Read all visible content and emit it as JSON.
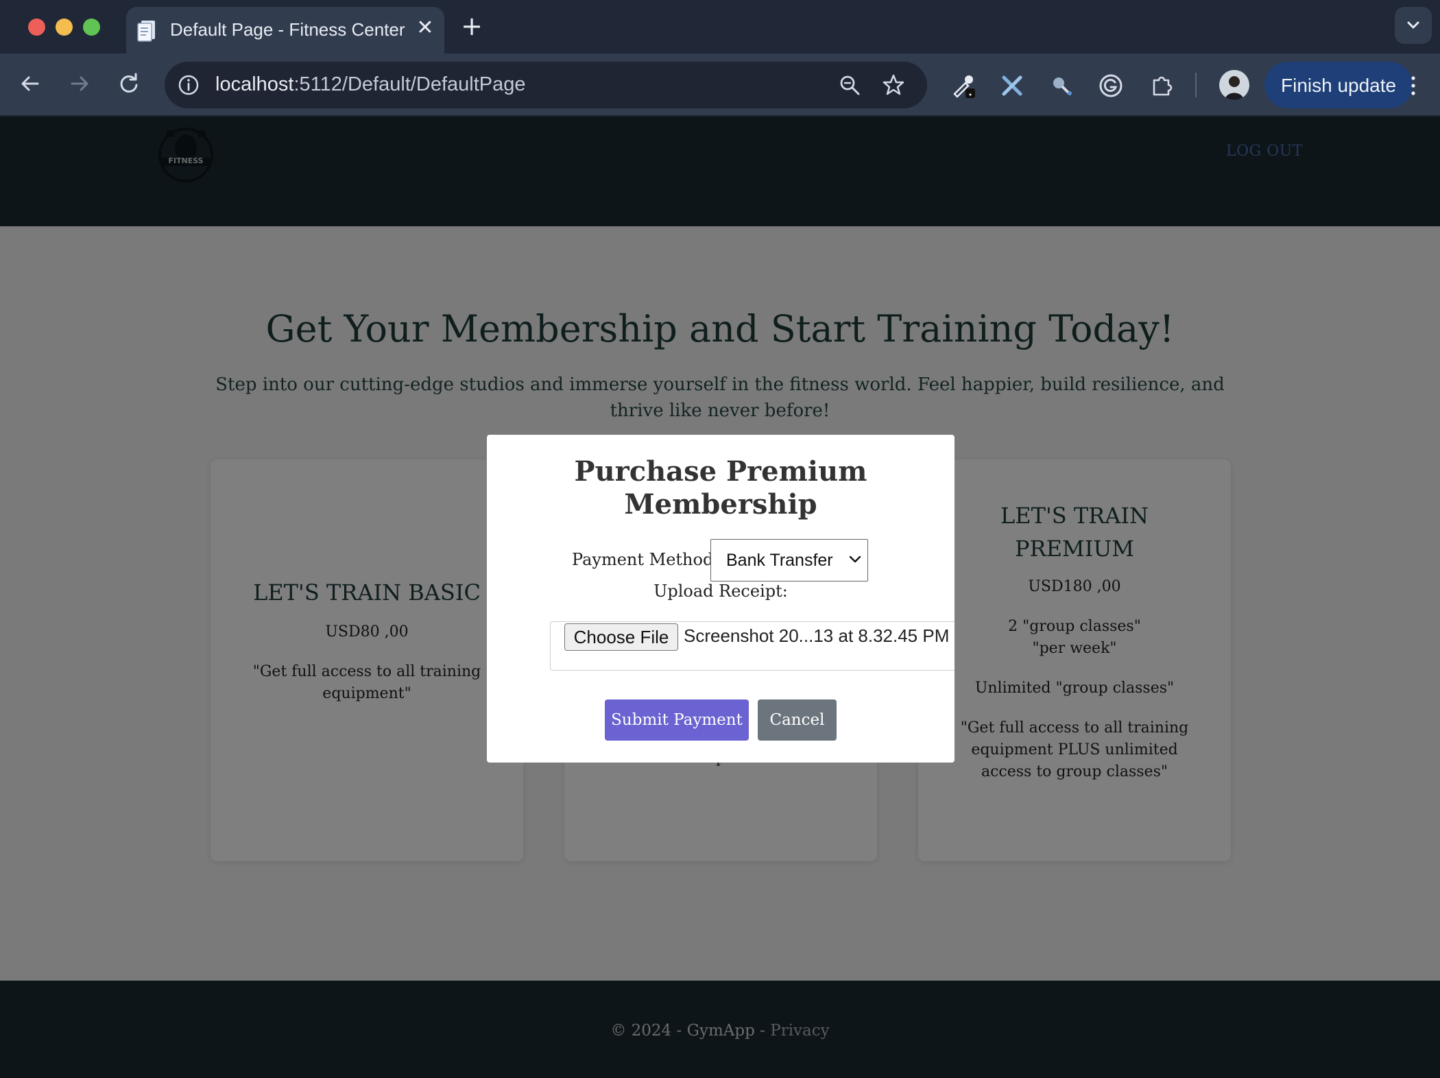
{
  "browser": {
    "tab_title": "Default Page - Fitness Center",
    "tab_close_glyph": "✕",
    "new_tab_glyph": "+",
    "url_host": "localhost",
    "url_path": ":5112/Default/DefaultPage",
    "finish_update_label": "Finish update",
    "icons": [
      "back-icon",
      "forward-icon",
      "reload-icon",
      "info-icon",
      "zoom-icon",
      "star-icon",
      "eyedropper-icon",
      "tools-icon",
      "search-extension-icon",
      "grammarly-icon",
      "extensions-icon",
      "avatar",
      "kebab-menu-icon"
    ]
  },
  "header": {
    "logo_text": "FITNESS",
    "logout_label": "LOG OUT"
  },
  "hero": {
    "title": "Get Your Membership and Start Training Today!",
    "text": "Step into our cutting-edge studios and immerse yourself in the fitness world. Feel happier, build resilience, and thrive like never before!"
  },
  "cards": [
    {
      "title": "LET'S TRAIN BASIC",
      "price": "USD80 ,00",
      "description": "\"Get full access to all training equipment\""
    },
    {
      "visible_fragment": "p"
    },
    {
      "title": "LET'S TRAIN PREMIUM",
      "price": "USD180 ,00",
      "classes_per_week": "2 \"group classes\"",
      "classes_per_week_2": "\"per week\"",
      "unlimited": "Unlimited \"group classes\"",
      "description": "\"Get full access to all training equipment PLUS unlimited access to group classes\""
    }
  ],
  "modal": {
    "title": "Purchase Premium Membership",
    "payment_method_label": "Payment Method:",
    "payment_method_value": "Bank Transfer",
    "upload_label": "Upload Receipt:",
    "choose_file_label": "Choose File",
    "file_name": "Screenshot 20...13 at 8.32.45 PM",
    "submit_label": "Submit Payment",
    "cancel_label": "Cancel"
  },
  "footer": {
    "copyright": "© 2024 - GymApp - ",
    "privacy_label": "Privacy"
  },
  "colors": {
    "header_bg": "#1c2b33",
    "hero_text": "#1e3d3b",
    "submit_bg": "#6a63d1",
    "cancel_bg": "#6c757d",
    "overlay": "rgba(0,0,0,0.5)"
  }
}
